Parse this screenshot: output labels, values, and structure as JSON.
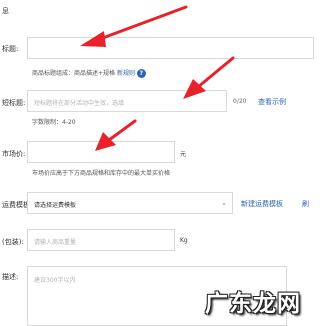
{
  "header": {
    "title_fragment": "息"
  },
  "title_field": {
    "label": "标题:",
    "hint_prefix": "商品标题组成：商品描述+规格",
    "rule_link": "新规则",
    "help_icon": "question-circle-icon"
  },
  "short_title_field": {
    "label": "短标题:",
    "placeholder": "短标题将在部分活动中生效，选填",
    "counter": "0/20",
    "example_link": "查看示例",
    "char_limit": "字数限制：4-20"
  },
  "market_price_field": {
    "label": "市场价:",
    "unit": "元",
    "hint": "市场价应高于下方商品规格和库存中的最大单买价格"
  },
  "shipping_field": {
    "label": "运费模板:",
    "selected": "请选择运费模板",
    "new_template_link": "新建运费模板",
    "refresh_link": "刷"
  },
  "weight_field": {
    "label": "(包装):",
    "placeholder": "请输入商品重量",
    "unit": "Kg"
  },
  "description_field": {
    "label": "描述:",
    "placeholder": "建议300字以内"
  },
  "watermark": "广东龙网",
  "colors": {
    "arrow": "#e8212a",
    "link": "#2f63b8",
    "border": "#d9d9d9"
  }
}
